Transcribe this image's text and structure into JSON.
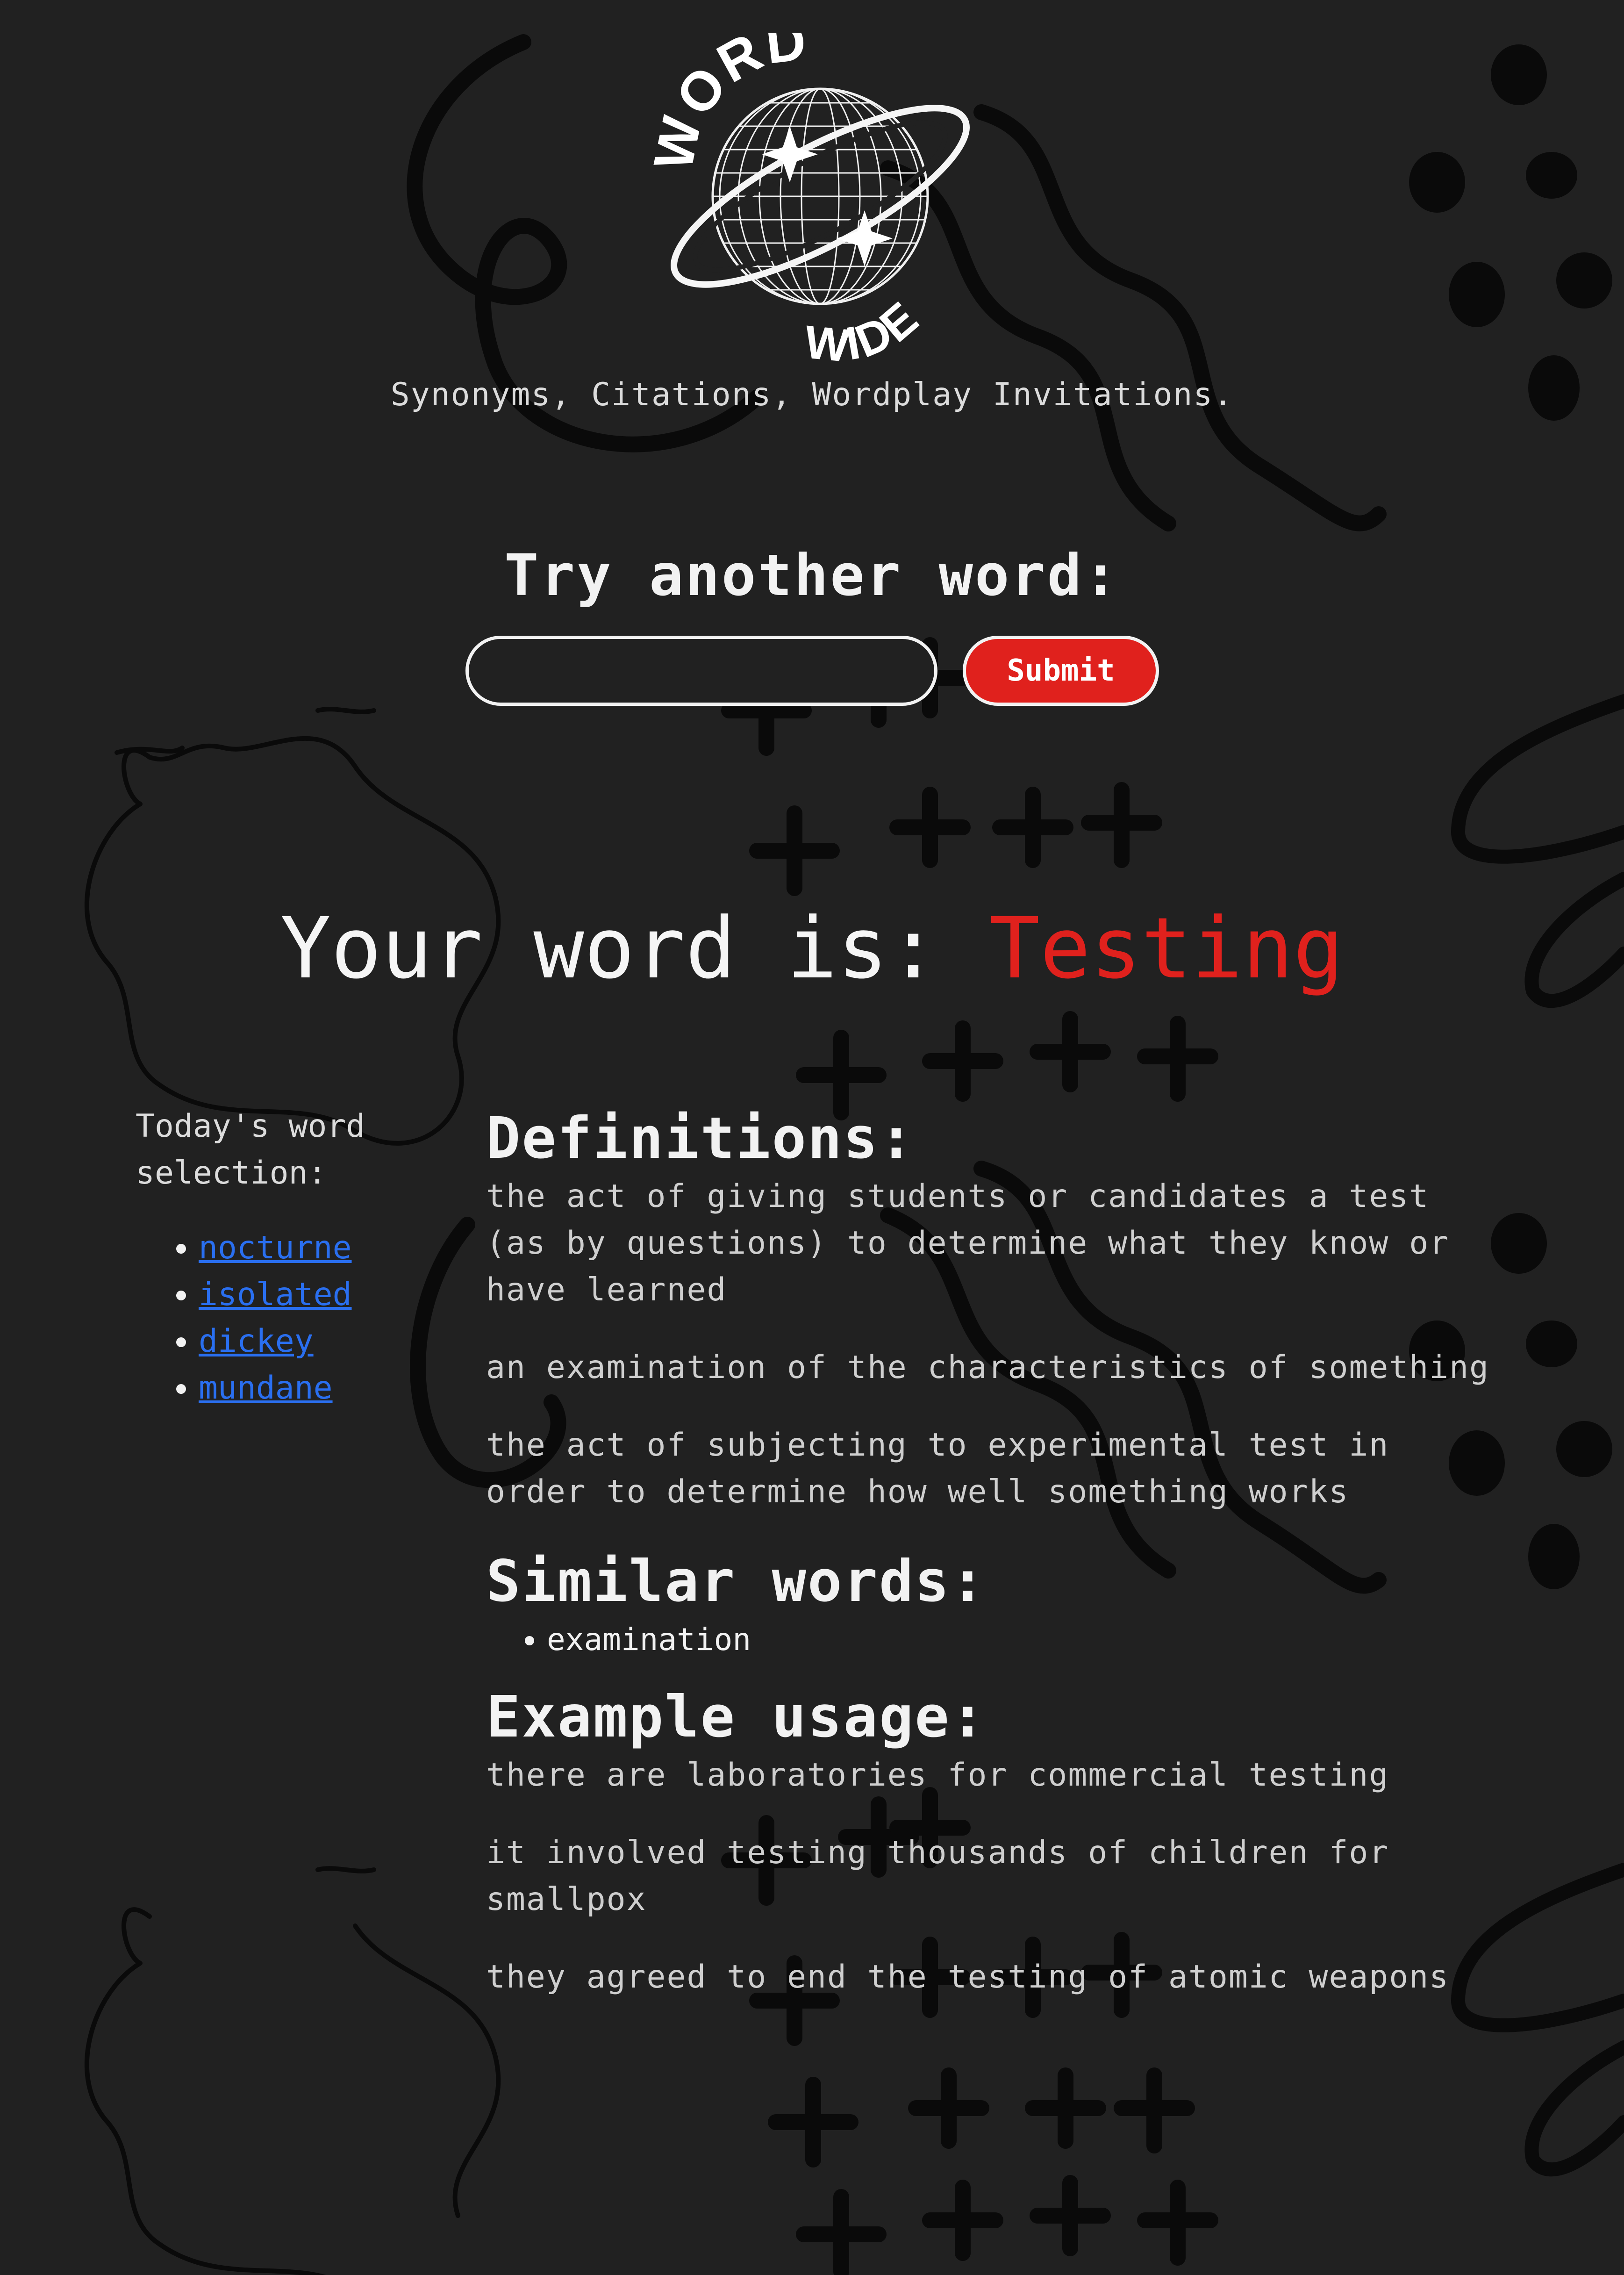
{
  "logo": {
    "top_text": "WORD",
    "bottom_text": "WIDE"
  },
  "tagline": "Synonyms, Citations, Wordplay Invitations.",
  "search": {
    "heading": "Try another word:",
    "value": "",
    "placeholder": "",
    "submit_label": "Submit"
  },
  "result": {
    "prefix": "Your word is:",
    "word": "Testing"
  },
  "sidebar": {
    "title": "Today's word selection:",
    "items": [
      "nocturne",
      "isolated",
      "dickey",
      "mundane"
    ]
  },
  "definitions": {
    "title": "Definitions:",
    "items": [
      "the act of giving students or candidates a test (as by questions) to determine what they know or have learned",
      "an examination of the characteristics of something",
      "the act of subjecting to experimental test in order to determine how well something works"
    ]
  },
  "similar": {
    "title": "Similar words:",
    "items": [
      "examination"
    ]
  },
  "examples": {
    "title": "Example usage:",
    "items": [
      "there are laboratories for commercial testing",
      "it involved testing thousands of children for smallpox",
      "they agreed to end the testing of atomic weapons"
    ]
  },
  "colors": {
    "background": "#212121",
    "accent": "#e0211d",
    "link": "#2a6ff0",
    "text": "#f2f2f2"
  }
}
